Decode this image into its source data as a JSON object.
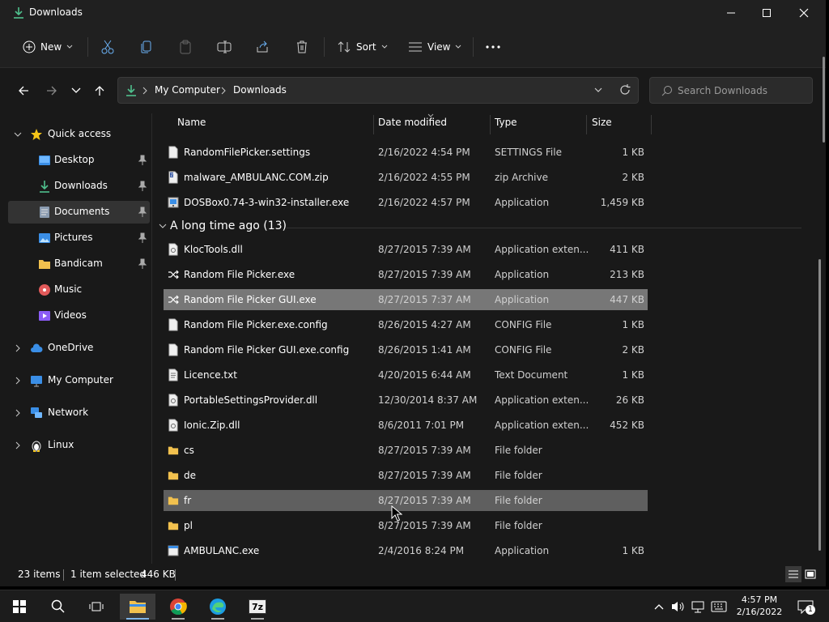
{
  "window": {
    "title": "Downloads"
  },
  "toolbar": {
    "new_label": "New",
    "sort_label": "Sort",
    "view_label": "View"
  },
  "address": {
    "crumbs": [
      "My Computer",
      "Downloads"
    ],
    "search_placeholder": "Search Downloads"
  },
  "sidebar": {
    "items": [
      {
        "label": "Quick access",
        "icon": "star-icon"
      },
      {
        "label": "Desktop",
        "icon": "desktop-icon"
      },
      {
        "label": "Downloads",
        "icon": "download-icon"
      },
      {
        "label": "Documents",
        "icon": "documents-icon"
      },
      {
        "label": "Pictures",
        "icon": "pictures-icon"
      },
      {
        "label": "Bandicam",
        "icon": "folder-icon"
      },
      {
        "label": "Music",
        "icon": "music-icon"
      },
      {
        "label": "Videos",
        "icon": "videos-icon"
      },
      {
        "label": "OneDrive",
        "icon": "cloud-icon"
      },
      {
        "label": "My Computer",
        "icon": "computer-icon"
      },
      {
        "label": "Network",
        "icon": "network-icon"
      },
      {
        "label": "Linux",
        "icon": "linux-icon"
      }
    ]
  },
  "columns": {
    "name": "Name",
    "date": "Date modified",
    "type": "Type",
    "size": "Size"
  },
  "files_top": [
    {
      "name": "RandomFilePicker.settings",
      "date": "2/16/2022 4:54 PM",
      "type": "SETTINGS File",
      "size": "1 KB",
      "icon": "file-icon"
    },
    {
      "name": "malware_AMBULANC.COM.zip",
      "date": "2/16/2022 4:55 PM",
      "type": "zip Archive",
      "size": "2 KB",
      "icon": "zip-icon"
    },
    {
      "name": "DOSBox0.74-3-win32-installer.exe",
      "date": "2/16/2022 4:57 PM",
      "type": "Application",
      "size": "1,459 KB",
      "icon": "installer-icon"
    }
  ],
  "group": {
    "label": "A long time ago (13)"
  },
  "files_old": [
    {
      "name": "KlocTools.dll",
      "date": "8/27/2015 7:39 AM",
      "type": "Application exten...",
      "size": "411 KB",
      "icon": "dll-icon"
    },
    {
      "name": "Random File Picker.exe",
      "date": "8/27/2015 7:39 AM",
      "type": "Application",
      "size": "213 KB",
      "icon": "shuffle-icon"
    },
    {
      "name": "Random File Picker GUI.exe",
      "date": "8/27/2015 7:37 AM",
      "type": "Application",
      "size": "447 KB",
      "icon": "shuffle-icon"
    },
    {
      "name": "Random File Picker.exe.config",
      "date": "8/26/2015 4:27 AM",
      "type": "CONFIG File",
      "size": "1 KB",
      "icon": "file-icon"
    },
    {
      "name": "Random File Picker GUI.exe.config",
      "date": "8/26/2015 1:41 AM",
      "type": "CONFIG File",
      "size": "2 KB",
      "icon": "file-icon"
    },
    {
      "name": "Licence.txt",
      "date": "4/20/2015 6:44 AM",
      "type": "Text Document",
      "size": "1 KB",
      "icon": "text-file-icon"
    },
    {
      "name": "PortableSettingsProvider.dll",
      "date": "12/30/2014 8:37 AM",
      "type": "Application exten...",
      "size": "26 KB",
      "icon": "dll-icon"
    },
    {
      "name": "Ionic.Zip.dll",
      "date": "8/6/2011 7:01 PM",
      "type": "Application exten...",
      "size": "452 KB",
      "icon": "dll-icon"
    },
    {
      "name": "cs",
      "date": "8/27/2015 7:39 AM",
      "type": "File folder",
      "size": "",
      "icon": "folder-icon"
    },
    {
      "name": "de",
      "date": "8/27/2015 7:39 AM",
      "type": "File folder",
      "size": "",
      "icon": "folder-icon"
    },
    {
      "name": "fr",
      "date": "8/27/2015 7:39 AM",
      "type": "File folder",
      "size": "",
      "icon": "folder-icon"
    },
    {
      "name": "pl",
      "date": "8/27/2015 7:39 AM",
      "type": "File folder",
      "size": "",
      "icon": "folder-icon"
    },
    {
      "name": "AMBULANC.exe",
      "date": "2/4/2016 8:24 PM",
      "type": "Application",
      "size": "1 KB",
      "icon": "exe-icon"
    }
  ],
  "status": {
    "items": "23 items",
    "selected": "1 item selected",
    "selected_size": "446 KB"
  },
  "taskbar": {
    "time": "4:57 PM",
    "date": "2/16/2022",
    "notification_count": "1",
    "sevenzip_label": "7z"
  }
}
